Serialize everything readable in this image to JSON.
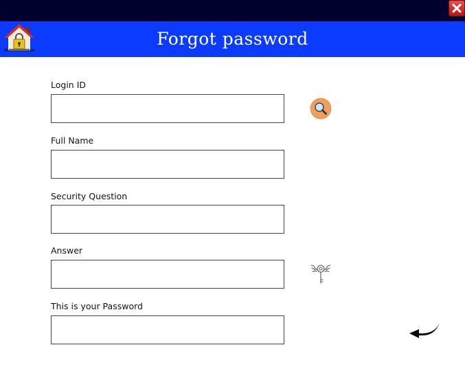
{
  "window": {
    "close_icon": "close-icon"
  },
  "header": {
    "title": "Forgot password",
    "home_icon": "home-lock-icon",
    "background_color": "#0a3bff",
    "titlebar_color": "#01012e"
  },
  "form": {
    "fields": [
      {
        "label": "Login ID",
        "value": ""
      },
      {
        "label": "Full Name",
        "value": ""
      },
      {
        "label": "Security Question",
        "value": ""
      },
      {
        "label": "Answer",
        "value": ""
      },
      {
        "label": "This is your Password",
        "value": ""
      }
    ],
    "search_icon": "search-icon",
    "key_icon": "key-icon",
    "back_icon": "back-arrow-icon"
  }
}
